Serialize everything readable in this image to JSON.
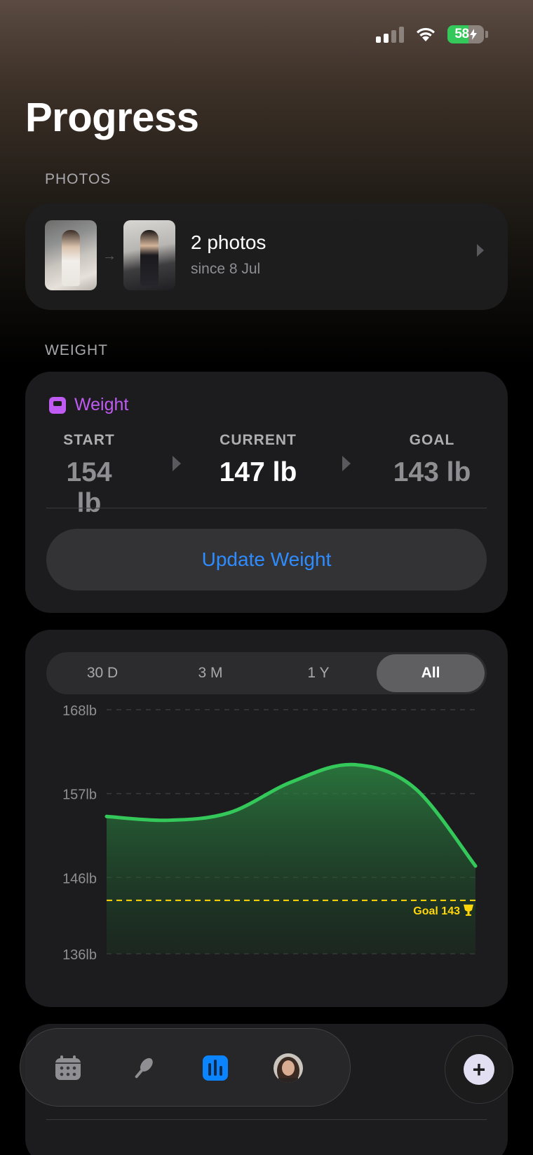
{
  "status_bar": {
    "battery_level": "58",
    "battery_fraction": 0.58,
    "battery_color": "#34c759"
  },
  "page": {
    "title": "Progress"
  },
  "photos": {
    "section_label": "PHOTOS",
    "count_label": "2 photos",
    "since_label": "since 8 Jul"
  },
  "weight": {
    "section_label": "WEIGHT",
    "card_title": "Weight",
    "accent_color": "#bf5af2",
    "start": {
      "label": "START",
      "value": "154 lb"
    },
    "current": {
      "label": "CURRENT",
      "value": "147 lb"
    },
    "goal": {
      "label": "GOAL",
      "value": "143 lb"
    },
    "update_button": "Update Weight",
    "button_color": "#2f8cff"
  },
  "range_tabs": {
    "items": [
      "30 D",
      "3 M",
      "1 Y",
      "All"
    ],
    "selected": "All"
  },
  "chart_data": {
    "type": "area",
    "title": "",
    "xlabel": "",
    "ylabel": "",
    "y_ticks": [
      "168lb",
      "157lb",
      "146lb",
      "136lb"
    ],
    "y_tick_values": [
      168,
      157,
      146,
      136
    ],
    "ylim": [
      136,
      168
    ],
    "x": [
      0,
      1,
      2,
      3,
      4,
      5,
      6
    ],
    "series": [
      {
        "values": [
          154,
          153.5,
          154.5,
          158.5,
          160.8,
          157.8,
          147.5
        ]
      }
    ],
    "goal_line": {
      "value": 143,
      "label": "Goal 143",
      "color": "#ffd60a"
    },
    "line_color": "#34c759",
    "grid": true
  },
  "tab_bar": {
    "items": [
      "calendar-icon",
      "meal-icon",
      "progress-icon",
      "profile-avatar"
    ],
    "active": "progress-icon",
    "active_color": "#0a84ff"
  },
  "fab": {
    "label": "+"
  }
}
